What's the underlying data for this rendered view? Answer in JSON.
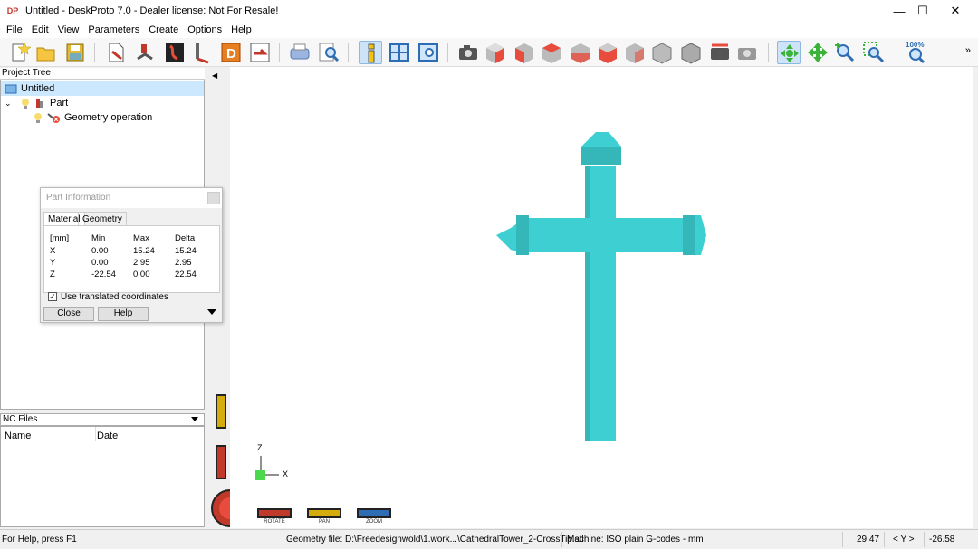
{
  "window": {
    "title": "Untitled - DeskProto 7.0 - Dealer license: Not For Resale!",
    "app_icon_text": "DP",
    "minimize": "—",
    "maximize": "☐",
    "close": "✕"
  },
  "menu": [
    "File",
    "Edit",
    "View",
    "Parameters",
    "Create",
    "Options",
    "Help"
  ],
  "toolbar": {
    "zoom_label": "100%",
    "more": "»"
  },
  "project_tree": {
    "header": "Project Tree",
    "root": "Untitled",
    "part": "Part",
    "operation": "Geometry operation"
  },
  "nc_files": {
    "header": "NC Files",
    "col_name": "Name",
    "col_date": "Date"
  },
  "part_info": {
    "title": "Part Information",
    "tabs": [
      "Material",
      "Geometry"
    ],
    "headers": [
      "[mm]",
      "Min",
      "Max",
      "Delta"
    ],
    "rows": [
      [
        "X",
        "0.00",
        "15.24",
        "15.24"
      ],
      [
        "Y",
        "0.00",
        "2.95",
        "2.95"
      ],
      [
        "Z",
        "-22.54",
        "0.00",
        "22.54"
      ]
    ],
    "checkbox_label": "Use translated coordinates",
    "checkbox_checked": true,
    "close_button": "Close",
    "help_button": "Help"
  },
  "viewport": {
    "axis_z": "Z",
    "axis_x": "X",
    "model_color": "#3ecfd2",
    "rotate_label": "ROTATE",
    "pan_label": "PAN",
    "zoom_label": "ZOOM"
  },
  "status": {
    "help": "For Help, press F1",
    "geometry_file": "Geometry file: D:\\Freedesignwold\\1.work...\\CathedralTower_2-CrossTip.stl",
    "machine": "Machine: ISO plain G-codes - mm",
    "coord1": "29.47",
    "axis": "< Y >",
    "coord2": "-26.58"
  }
}
